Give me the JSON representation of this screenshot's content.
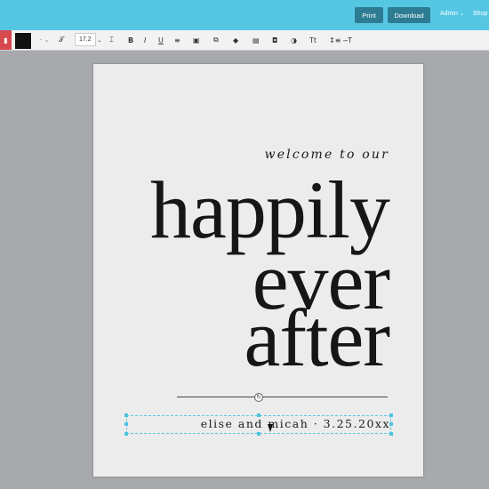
{
  "header": {
    "print_label": "Print",
    "download_label": "Download",
    "admin_label": "Admin",
    "shop_label": "Shop",
    "accent_color": "#55c7e3",
    "button_color": "#2e7c93"
  },
  "toolbar": {
    "delete_icon": "trash-icon",
    "text_color": "#121212",
    "font_dropdown": "-",
    "font_size": "17.2",
    "icons": [
      "font-icon",
      "letter-spacing-icon",
      "bold-icon",
      "italic-icon",
      "underline-icon",
      "align-right-icon",
      "crop-icon",
      "duplicate-icon",
      "layers-icon",
      "copy-icon",
      "lock-icon",
      "opacity-icon",
      "text-case-icon",
      "line-height-icon",
      "strikethrough-icon"
    ]
  },
  "canvas": {
    "welcome_text": "welcome to our",
    "headline_line1": "happily",
    "headline_line2": "ever",
    "headline_line3": "after",
    "names_line": "elise and micah · 3.25.20xx"
  }
}
